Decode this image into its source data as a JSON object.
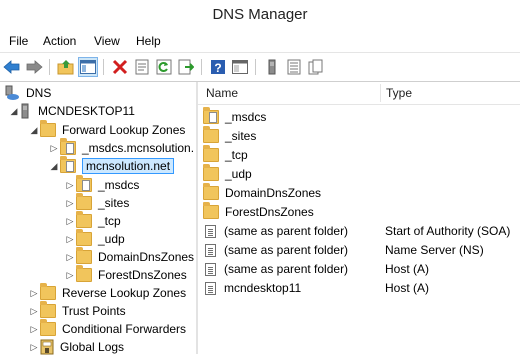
{
  "window": {
    "title": "DNS Manager"
  },
  "menu": [
    "File",
    "Action",
    "View",
    "Help"
  ],
  "toolbar": {
    "icons": [
      "back-icon",
      "forward-icon",
      "up-folder-icon",
      "show-hide-tree-icon",
      "delete-icon",
      "properties-icon",
      "refresh-icon",
      "export-list-icon",
      "help-icon",
      "console-tree-icon",
      "server-icon",
      "record-list-icon",
      "copy-icon"
    ]
  },
  "tree": {
    "root": "DNS",
    "server": "MCNDESKTOP11",
    "forward_zones": "Forward Lookup Zones",
    "msdcs_zone": "_msdcs.mcnsolution.",
    "zone": "mcnsolution.net",
    "zone_children": [
      "_msdcs",
      "_sites",
      "_tcp",
      "_udp",
      "DomainDnsZones",
      "ForestDnsZones"
    ],
    "reverse_zones": "Reverse Lookup Zones",
    "trust_points": "Trust Points",
    "conditional_forwarders": "Conditional Forwarders",
    "global_logs": "Global Logs"
  },
  "list": {
    "columns": {
      "name": "Name",
      "type": "Type"
    },
    "rows": [
      {
        "name": "_msdcs",
        "type": ""
      },
      {
        "name": "_sites",
        "type": ""
      },
      {
        "name": "_tcp",
        "type": ""
      },
      {
        "name": "_udp",
        "type": ""
      },
      {
        "name": "DomainDnsZones",
        "type": ""
      },
      {
        "name": "ForestDnsZones",
        "type": ""
      },
      {
        "name": "(same as parent folder)",
        "type": "Start of Authority (SOA)"
      },
      {
        "name": "(same as parent folder)",
        "type": "Name Server (NS)"
      },
      {
        "name": "(same as parent folder)",
        "type": "Host (A)"
      },
      {
        "name": "mcndesktop11",
        "type": "Host (A)"
      }
    ]
  },
  "colors": {
    "selection_bg": "#cce8ff",
    "selection_border": "#3399ff",
    "folder": "#f1c55c"
  }
}
